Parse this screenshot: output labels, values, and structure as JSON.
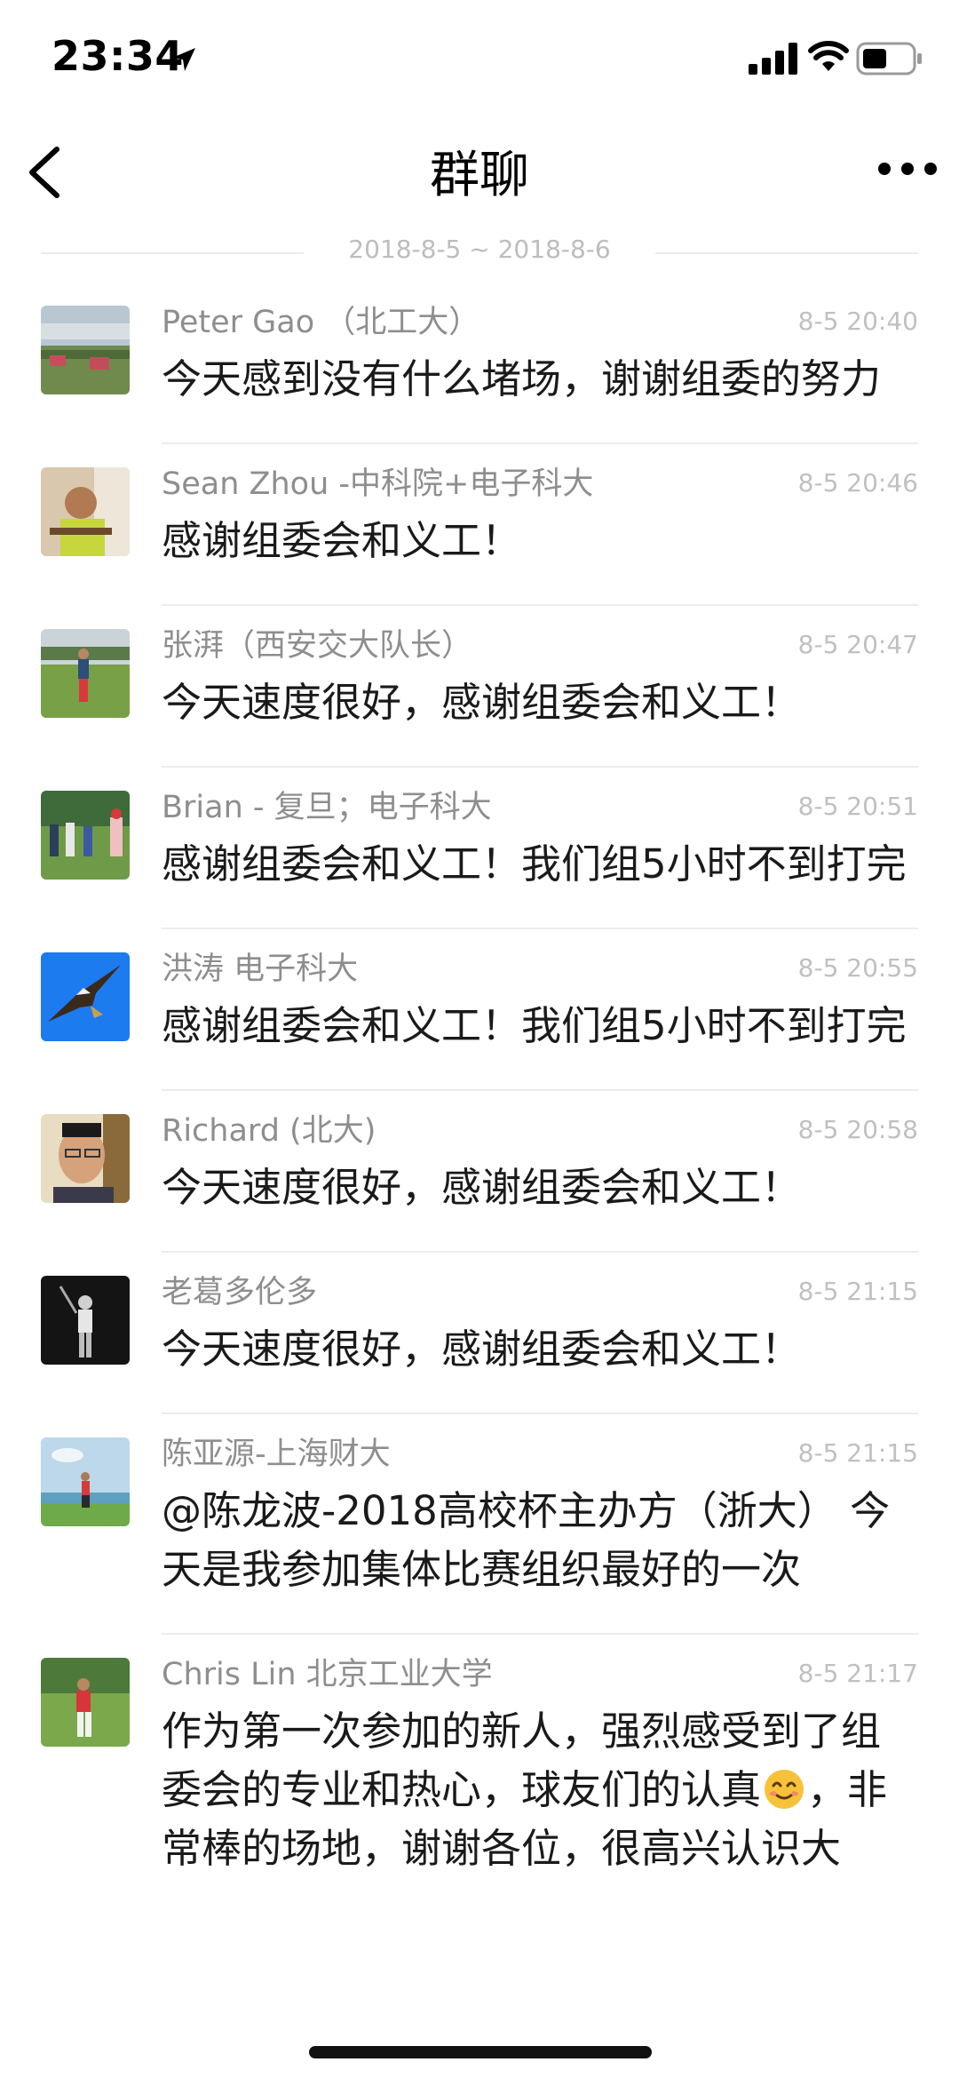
{
  "status_bar": {
    "time": "23:34"
  },
  "nav": {
    "title": "群聊"
  },
  "date_range": "2018-8-5 ~ 2018-8-6",
  "messages": [
    {
      "sender": "Peter Gao （北工大）",
      "time": "8-5 20:40",
      "text": "今天感到没有什么堵场，谢谢组委的努力",
      "avatar": "golf-cart-avatar"
    },
    {
      "sender": "Sean Zhou -中科院+电子科大",
      "time": "8-5 20:46",
      "text": "感谢组委会和义工！",
      "avatar": "guitar-man-avatar"
    },
    {
      "sender": "张湃（西安交大队长）",
      "time": "8-5 20:47",
      "text": "今天速度很好，感谢组委会和义工！",
      "avatar": "golfer-swing-avatar"
    },
    {
      "sender": "Brian - 复旦；电子科大",
      "time": "8-5 20:51",
      "text": "感谢组委会和义工！我们组5小时不到打完",
      "avatar": "golf-group-avatar"
    },
    {
      "sender": "洪涛 电子科大",
      "time": "8-5 20:55",
      "text": "感谢组委会和义工！我们组5小时不到打完",
      "avatar": "eagle-avatar"
    },
    {
      "sender": "Richard (北大)",
      "time": "8-5 20:58",
      "text": "今天速度很好，感谢组委会和义工！",
      "avatar": "man-glasses-avatar"
    },
    {
      "sender": "老葛多伦多",
      "time": "8-5 21:15",
      "text": "今天速度很好，感谢组委会和义工！",
      "avatar": "bw-golfer-avatar"
    },
    {
      "sender": "陈亚源-上海财大",
      "time": "8-5 21:15",
      "text": "@陈龙波-2018高校杯主办方（浙大） 今天是我参加集体比赛组织最好的一次",
      "avatar": "beach-golfer-avatar"
    },
    {
      "sender": "Chris Lin 北京工业大学",
      "time": "8-5 21:17",
      "text_before_emoji": "作为第一次参加的新人，强烈感受到了组委会的专业和热心，球友们的认真",
      "text_after_emoji": "，非常棒的场地，谢谢各位，很高兴认识大",
      "avatar": "red-shirt-golfer-avatar"
    }
  ],
  "colors": {
    "sender": "#8e8e8e",
    "time": "#c0c0c0",
    "divider": "#ececec",
    "text": "#1a1a1a"
  }
}
